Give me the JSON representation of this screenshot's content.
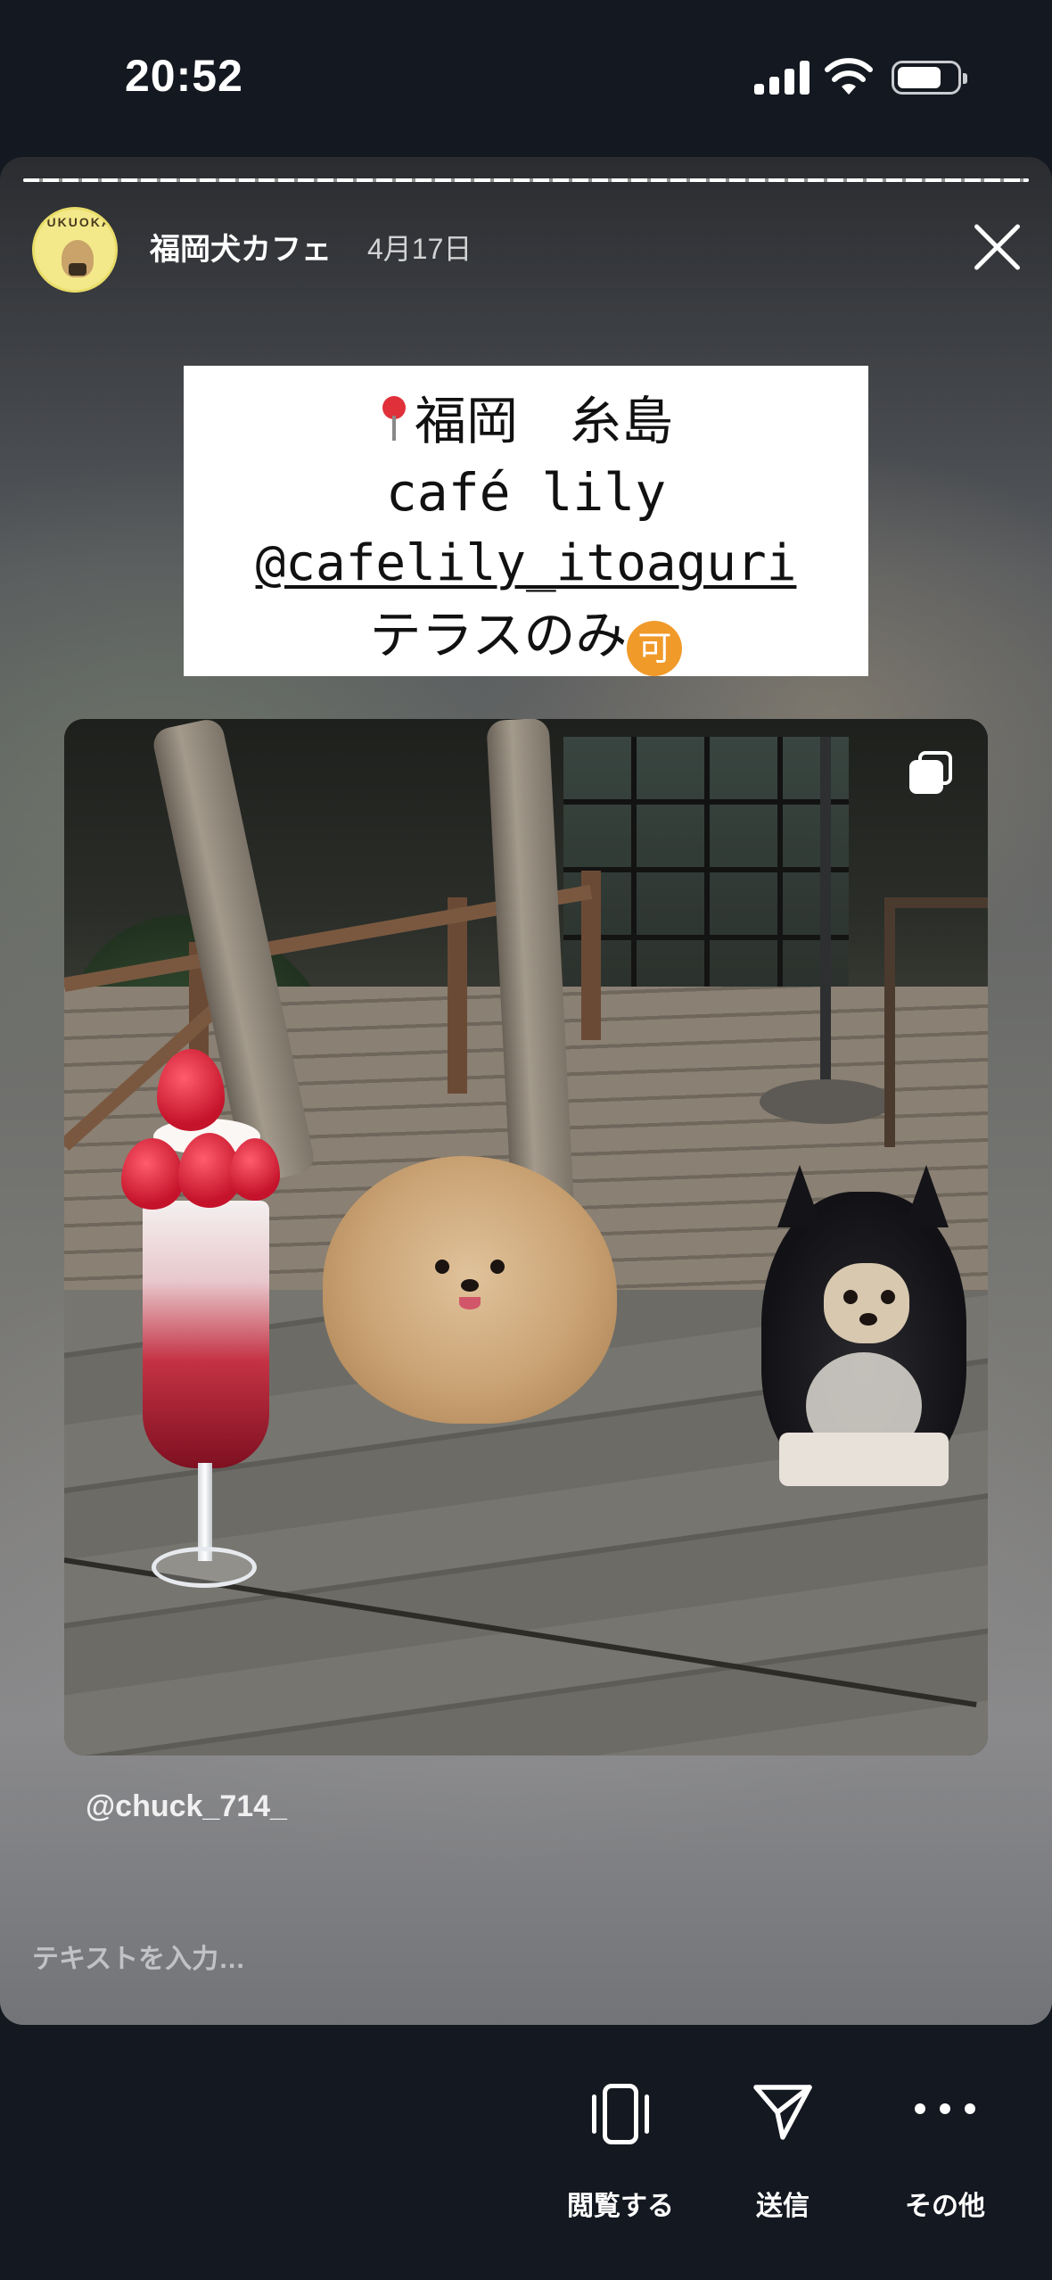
{
  "status_bar": {
    "time": "20:52",
    "signal_icon": "cellular-signal-icon",
    "wifi_icon": "wifi-icon",
    "battery_icon": "battery-icon"
  },
  "story": {
    "progress": 1.0,
    "account": {
      "name": "福岡犬カフェ",
      "date": "4月17日",
      "avatar_text": "FUKUOKA"
    },
    "caption": {
      "line1": "福岡　糸島",
      "line2": "café lily",
      "line3": "@cafelily_itoaguri",
      "line4": "テラスのみ",
      "badge": "可",
      "pin_icon": "round-pushpin-icon"
    },
    "photo_icon": "multiple-posts-icon",
    "mention": "@chuck_714_",
    "reply_placeholder": "テキストを入力…"
  },
  "actions": {
    "view_label": "閲覧する",
    "send_label": "送信",
    "more_label": "その他"
  },
  "colors": {
    "background": "#141820",
    "caption_bg": "#ffffff",
    "badge": "#f09a2a"
  }
}
